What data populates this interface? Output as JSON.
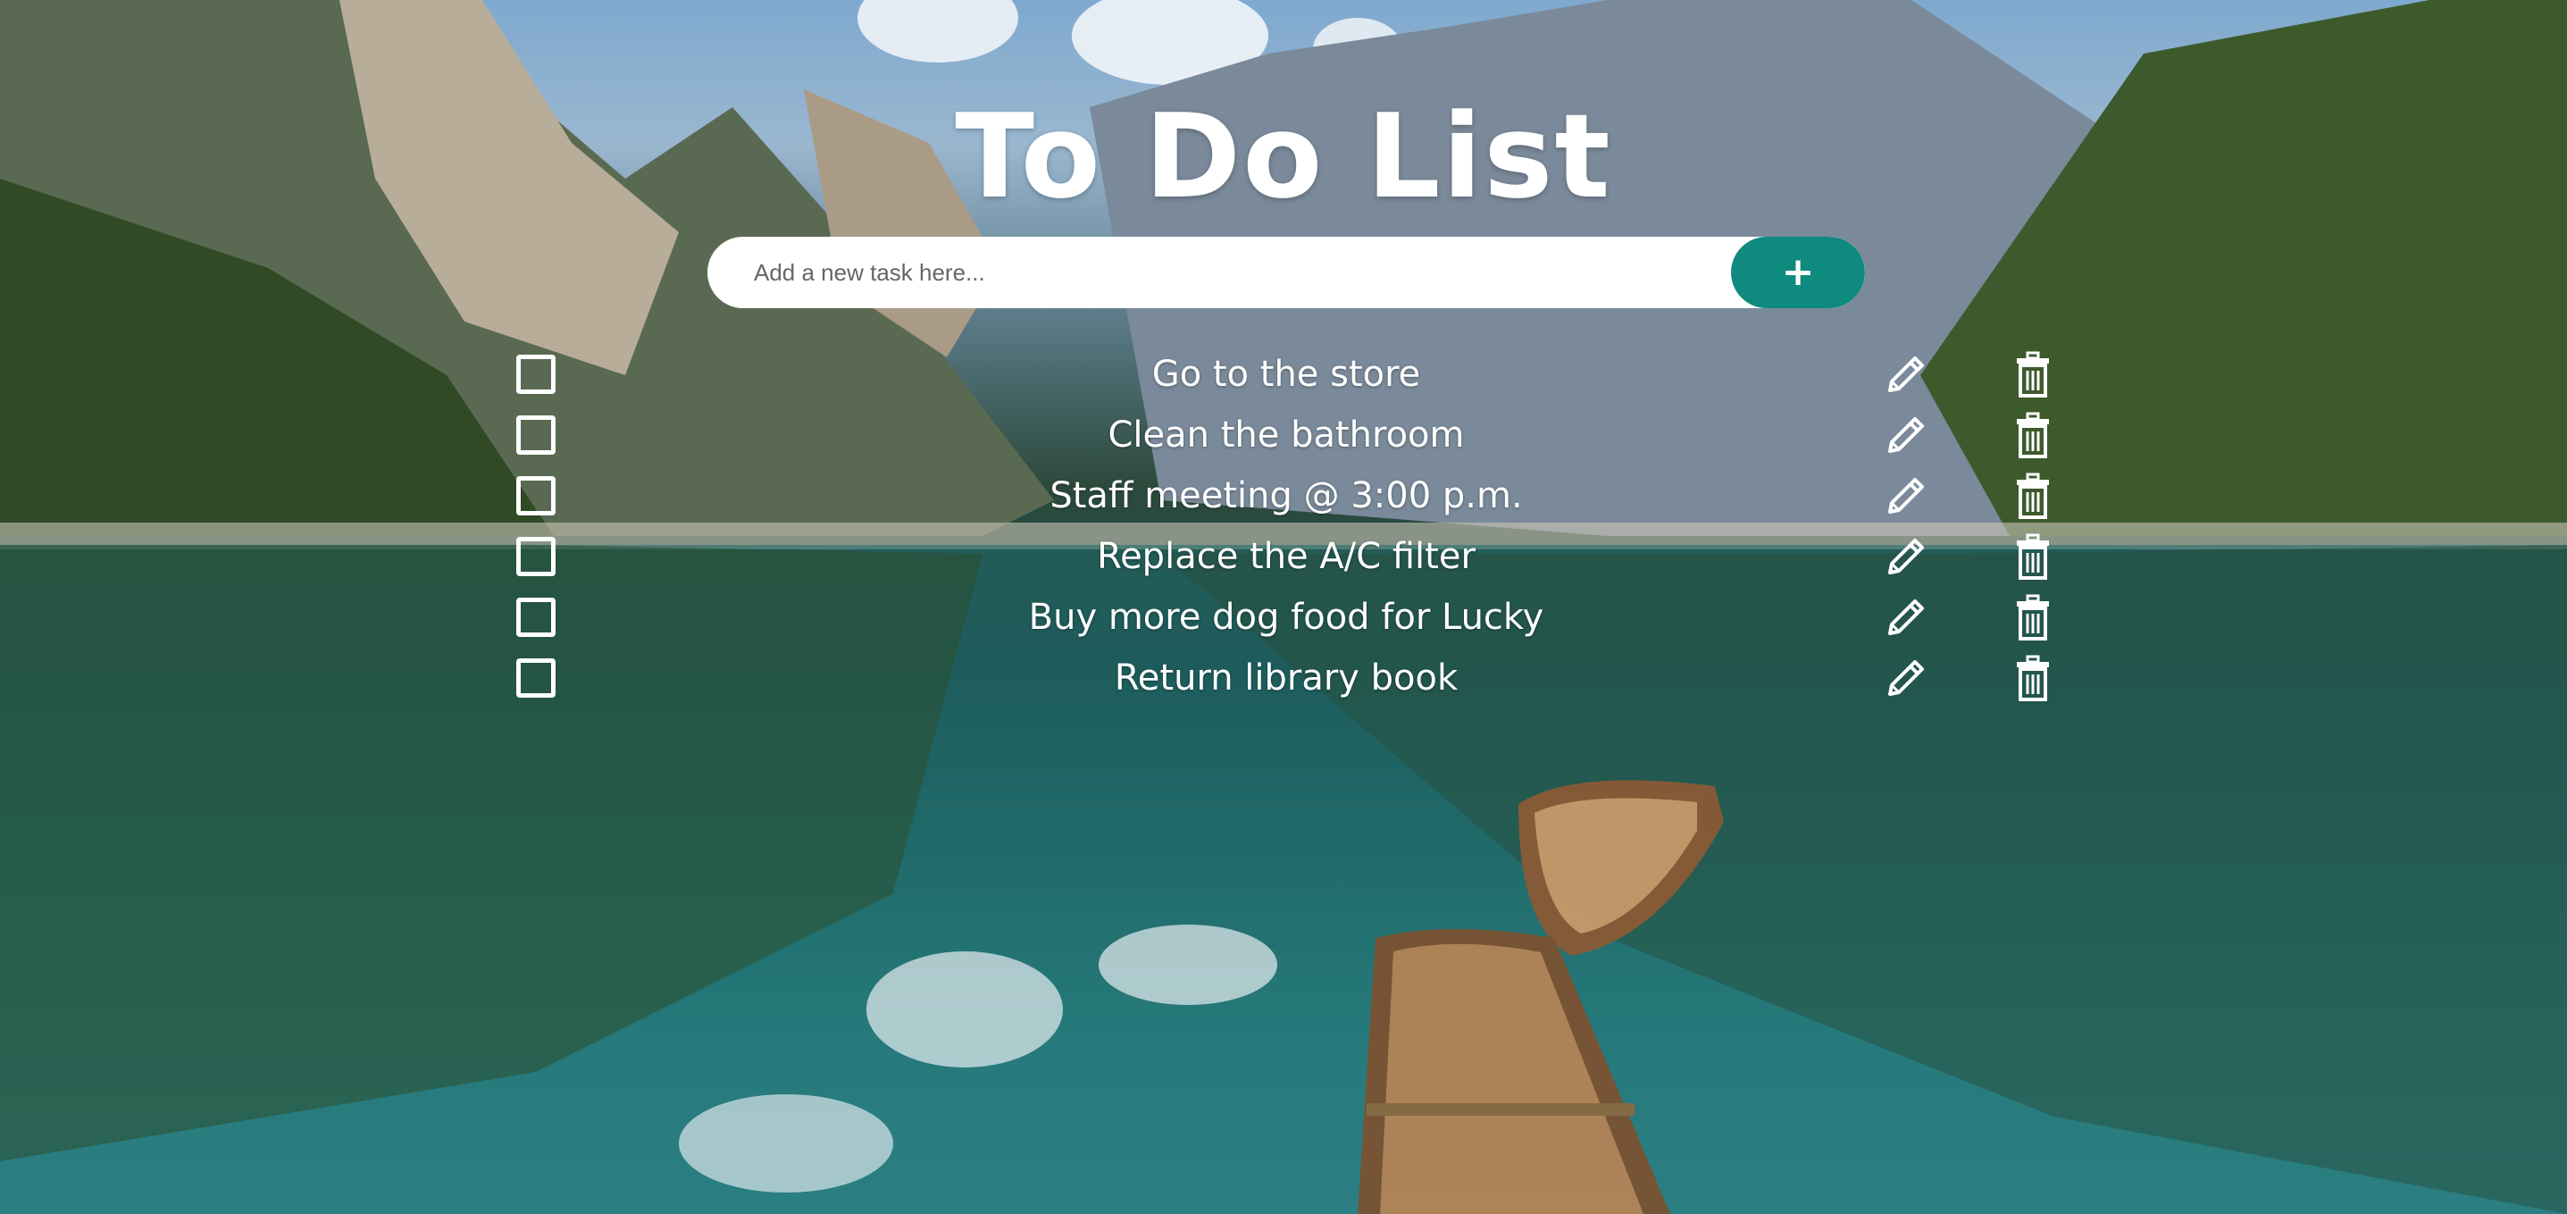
{
  "app": {
    "title": "To Do List"
  },
  "new_task": {
    "placeholder": "Add a new task here...",
    "value": "",
    "add_button_label": "+"
  },
  "tasks": [
    {
      "text": "Go to the store",
      "checked": false
    },
    {
      "text": "Clean the bathroom",
      "checked": false
    },
    {
      "text": "Staff meeting @ 3:00 p.m.",
      "checked": false
    },
    {
      "text": "Replace the A/C filter",
      "checked": false
    },
    {
      "text": "Buy more dog food for Lucky",
      "checked": false
    },
    {
      "text": "Return library book",
      "checked": false
    }
  ],
  "icons": {
    "add": "plus-icon",
    "edit": "pencil-icon",
    "delete": "trash-icon",
    "complete": "checkbox-empty"
  },
  "colors": {
    "accent": "#0f8a7e",
    "text": "#ffffff",
    "input_bg": "#ffffff"
  }
}
